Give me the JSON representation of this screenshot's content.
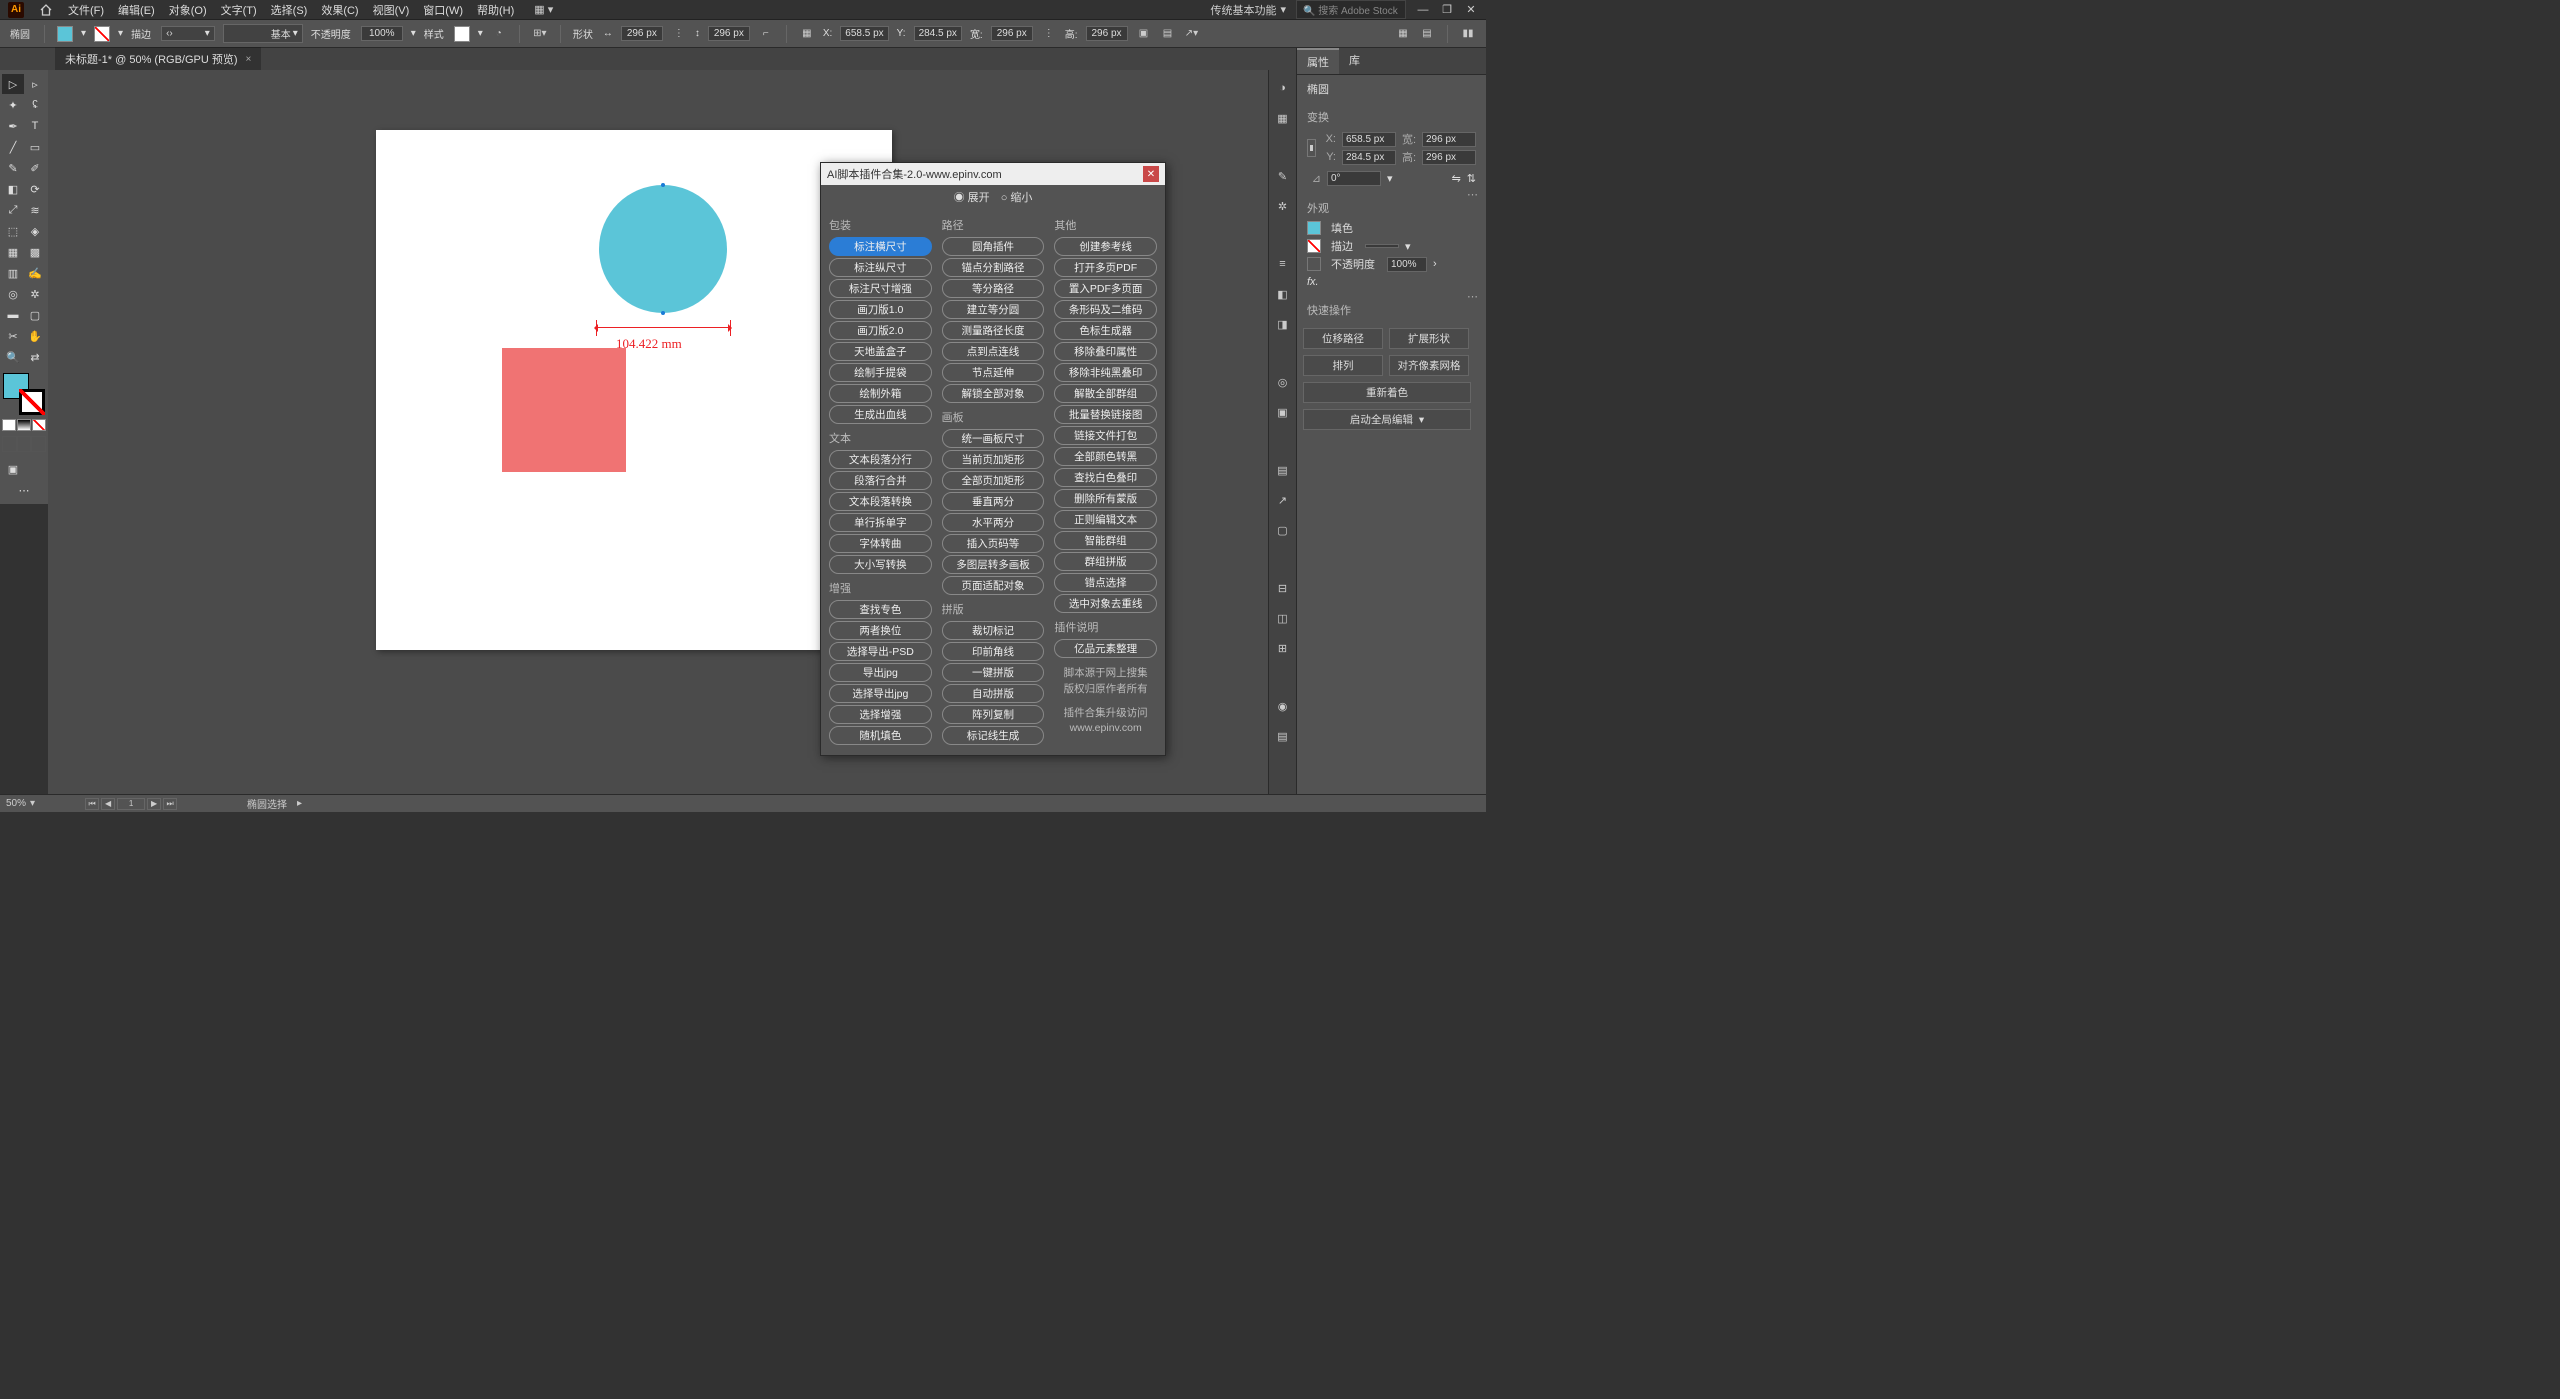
{
  "menubar": {
    "items": [
      "文件(F)",
      "编辑(E)",
      "对象(O)",
      "文字(T)",
      "选择(S)",
      "效果(C)",
      "视图(V)",
      "窗口(W)",
      "帮助(H)"
    ],
    "workspace": "传统基本功能",
    "search_placeholder": "搜索 Adobe Stock"
  },
  "optbar": {
    "shape_label": "椭圆",
    "stroke_label": "描边",
    "stroke_style": "基本",
    "opacity_label": "不透明度",
    "opacity_value": "100%",
    "style_label": "样式",
    "shapekind_label": "形状",
    "w_value": "296 px",
    "h_value": "296 px",
    "x_label": "X:",
    "x_value": "658.5 px",
    "y_label": "Y:",
    "y_value": "284.5 px",
    "w2_value": "296 px",
    "h2_label": "高:",
    "h2_value": "296 px"
  },
  "doctab": {
    "title": "未标题-1* @ 50% (RGB/GPU 预览)"
  },
  "canvas": {
    "dim_text": "104.422 mm"
  },
  "plugin": {
    "title": "AI脚本插件合集-2.0-www.epinv.com",
    "radio_expand": "展开",
    "radio_collapse": "缩小",
    "groups": {
      "pack": {
        "title": "包装",
        "items": [
          "标注横尺寸",
          "标注纵尺寸",
          "标注尺寸增强",
          "画刀版1.0",
          "画刀版2.0",
          "天地盖盒子",
          "绘制手提袋",
          "绘制外箱",
          "生成出血线"
        ]
      },
      "text": {
        "title": "文本",
        "items": [
          "文本段落分行",
          "段落行合并",
          "文本段落转换",
          "单行拆单字",
          "字体转曲",
          "大小写转换"
        ]
      },
      "enh": {
        "title": "增强",
        "items": [
          "查找专色",
          "两者换位",
          "选择导出-PSD",
          "导出jpg",
          "选择导出jpg",
          "选择增强",
          "随机填色"
        ]
      },
      "path": {
        "title": "路径",
        "items": [
          "圆角插件",
          "锚点分割路径",
          "等分路径",
          "建立等分圆",
          "测量路径长度",
          "点到点连线",
          "节点延伸",
          "解锁全部对象"
        ]
      },
      "board": {
        "title": "画板",
        "items": [
          "统一画板尺寸",
          "当前页加矩形",
          "全部页加矩形",
          "垂直两分",
          "水平两分",
          "插入页码等",
          "多图层转多画板",
          "页面适配对象"
        ]
      },
      "merge": {
        "title": "拼版",
        "items": [
          "裁切标记",
          "印前角线",
          "一键拼版",
          "自动拼版",
          "阵列复制",
          "标记线生成"
        ]
      },
      "other": {
        "title": "其他",
        "items": [
          "创建参考线",
          "打开多页PDF",
          "置入PDF多页面",
          "条形码及二维码",
          "色标生成器",
          "移除叠印属性",
          "移除非纯黑叠印",
          "解散全部群组",
          "批量替换链接图",
          "链接文件打包",
          "全部颜色转黑",
          "查找白色叠印",
          "删除所有蒙版",
          "正则编辑文本",
          "智能群组",
          "群组拼版",
          "错点选择",
          "选中对象去重线"
        ]
      },
      "desc": {
        "title": "插件说明",
        "button": "亿品元素整理",
        "line1": "脚本源于网上搜集",
        "line2": "版权归原作者所有",
        "line3": "插件合集升级访问",
        "line4": "www.epinv.com"
      }
    }
  },
  "rpanel": {
    "tab_props": "属性",
    "tab_lib": "库",
    "shape_name": "椭圆",
    "transform_title": "变换",
    "x": "658.5 px",
    "y": "284.5 px",
    "w": "296 px",
    "h": "296 px",
    "angle": "0°",
    "appearance_title": "外观",
    "fill_label": "填色",
    "stroke_label": "描边",
    "opacity_label": "不透明度",
    "opacity_value": "100%",
    "fx": "fx.",
    "quick_title": "快速操作",
    "q1": "位移路径",
    "q2": "扩展形状",
    "q3": "排列",
    "q4": "对齐像素网格",
    "q5": "重新着色",
    "q6": "启动全局编辑"
  },
  "status": {
    "zoom": "50%",
    "page": "1",
    "tool": "椭圆选择"
  }
}
